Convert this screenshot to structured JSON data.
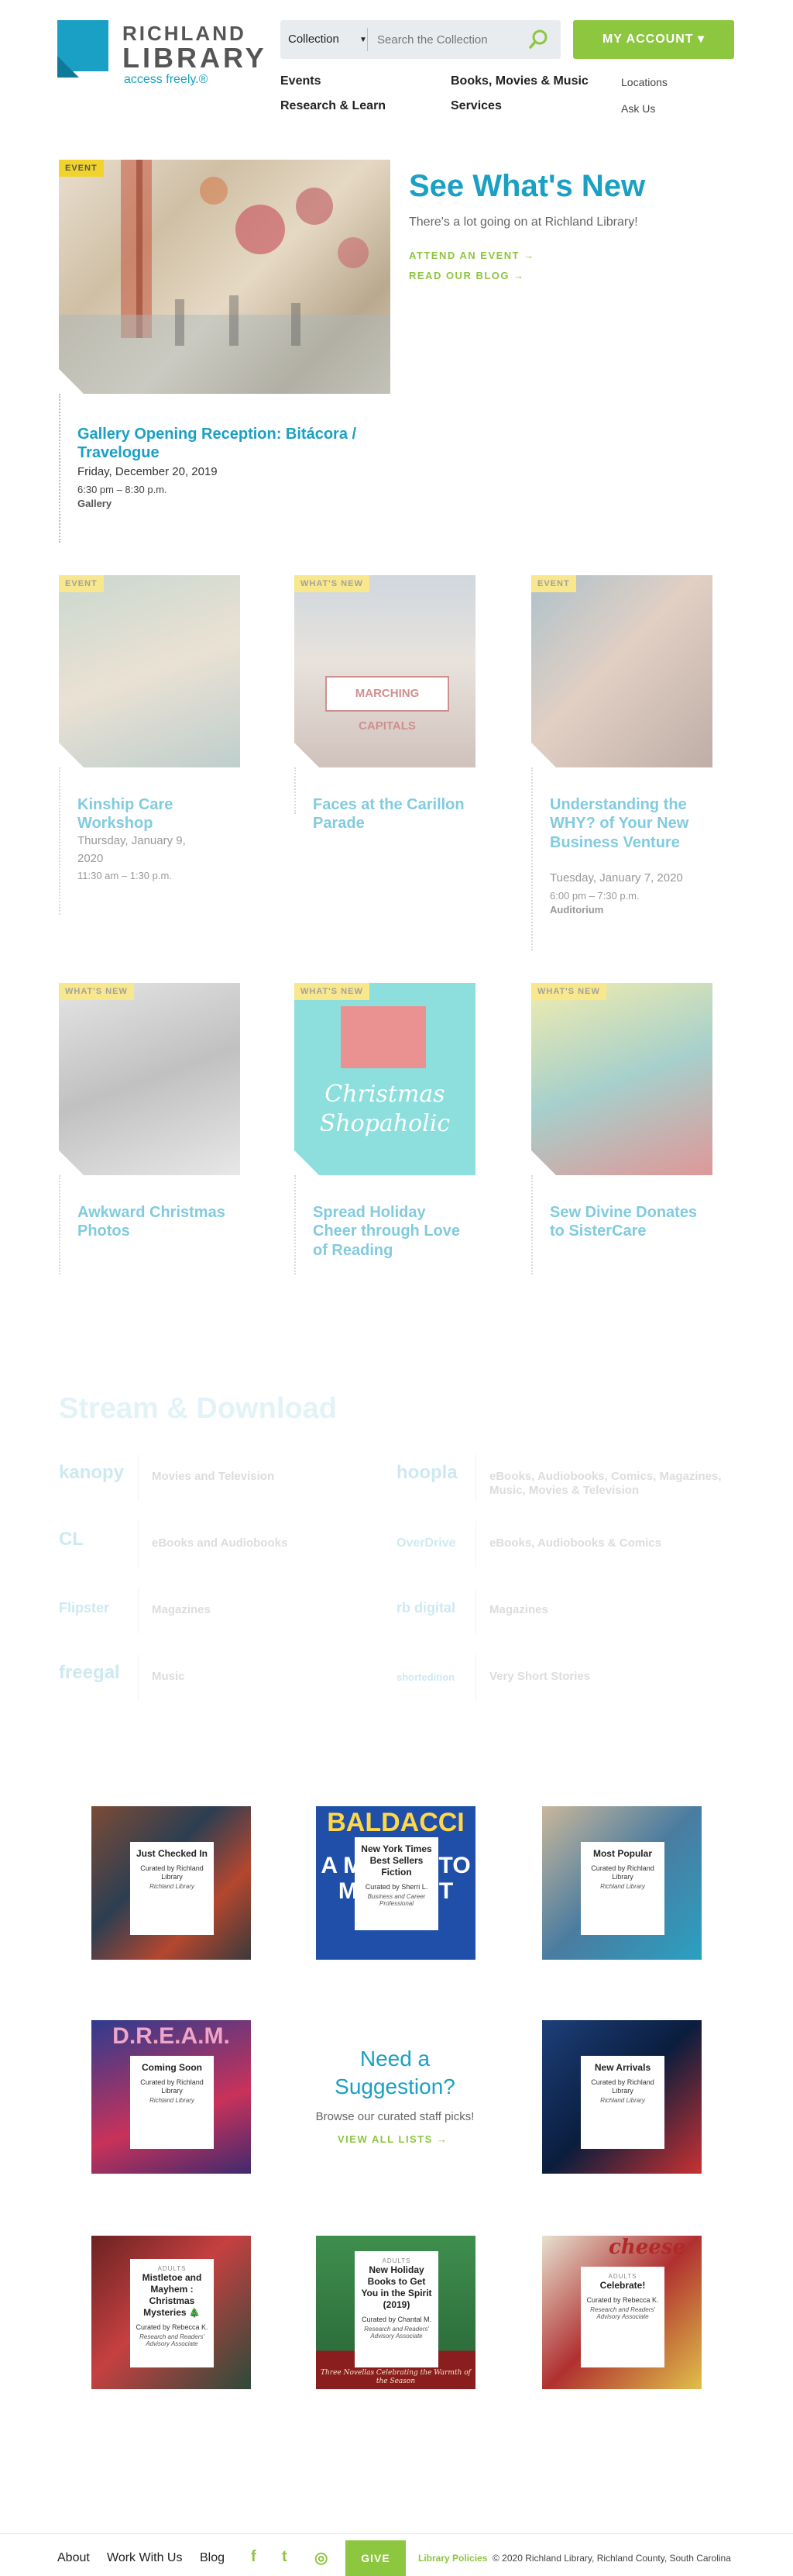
{
  "header": {
    "brand_line1": "RICHLAND",
    "brand_line2": "LIBRARY",
    "tagline": "access freely.®",
    "search_scope": "Collection",
    "search_placeholder": "Search the Collection",
    "account_label": "MY ACCOUNT"
  },
  "nav": {
    "events": "Events",
    "research": "Research & Learn",
    "books": "Books, Movies & Music",
    "services": "Services",
    "locations": "Locations",
    "ask": "Ask Us"
  },
  "featured": {
    "tag": "EVENT",
    "title": "Gallery Opening Reception: Bitácora / Travelogue",
    "date": "Friday, December 20, 2019",
    "time": "6:30 pm – 8:30 p.m.",
    "place": "Gallery"
  },
  "whats_new": {
    "title": "See What's New",
    "subtitle": "There's a lot going on at Richland Library!",
    "link1": "ATTEND AN EVENT →",
    "link2": "READ OUR BLOG →"
  },
  "cards": [
    {
      "tag": "EVENT",
      "title": "Kinship Care Workshop",
      "date": "Thursday, January 9, 2020",
      "time": "11:30 am – 1:30 p.m.",
      "place": ""
    },
    {
      "tag": "WHAT'S NEW",
      "title": "Faces at the Carillon Parade",
      "date": "",
      "time": "",
      "place": ""
    },
    {
      "tag": "EVENT",
      "title": "Understanding the WHY? of Your New Business Venture",
      "date": "Tuesday, January 7, 2020",
      "time": "6:00 pm – 7:30 p.m.",
      "place": "Auditorium"
    },
    {
      "tag": "WHAT'S NEW",
      "title": "Awkward Christmas Photos",
      "date": "",
      "time": "",
      "place": ""
    },
    {
      "tag": "WHAT'S NEW",
      "title": "Spread Holiday Cheer through Love of Reading",
      "date": "",
      "time": "",
      "place": ""
    },
    {
      "tag": "WHAT'S NEW",
      "title": "Sew Divine Donates to SisterCare",
      "date": "",
      "time": "",
      "place": ""
    }
  ],
  "card_image_text": {
    "parade": "MARCHING CAPITALS",
    "xmas_line1": "Christmas",
    "xmas_line2": "Shopaholic"
  },
  "stream": {
    "title": "Stream & Download",
    "rows": [
      {
        "logo": "kanopy",
        "text": "Movies and Television"
      },
      {
        "logo": "hoopla",
        "text": "eBooks, Audiobooks, Comics, Magazines, Music, Movies & Television"
      },
      {
        "logo": "CL",
        "text": "eBooks and Audiobooks"
      },
      {
        "logo": "OverDrive",
        "text": "eBooks, Audiobooks & Comics"
      },
      {
        "logo": "Flipster",
        "text": "Magazines"
      },
      {
        "logo": "rb digital",
        "text": "Magazines"
      },
      {
        "logo": "freegal",
        "text": "Music"
      },
      {
        "logo": "shortedition",
        "text": "Very Short Stories"
      }
    ]
  },
  "lists": [
    {
      "title": "Just Checked In",
      "by": "Curated by Richland Library",
      "sub": "Richland Library",
      "adults": ""
    },
    {
      "title": "New York Times Best Sellers Fiction",
      "by": "Curated by Sherri L.",
      "sub": "Business and Career Professional",
      "adults": ""
    },
    {
      "title": "Most Popular",
      "by": "Curated by Richland Library",
      "sub": "Richland Library",
      "adults": ""
    },
    {
      "title": "Coming Soon",
      "by": "Curated by Richland Library",
      "sub": "Richland Library",
      "adults": ""
    },
    {
      "title": "New Arrivals",
      "by": "Curated by Richland Library",
      "sub": "Richland Library",
      "adults": ""
    },
    {
      "title": "Mistletoe and Mayhem : Christmas Mysteries 🎄",
      "by": "Curated by Rebecca K.",
      "sub": "Research and Readers' Advisory Associate",
      "adults": "ADULTS"
    },
    {
      "title": "New Holiday Books to Get You in the Spirit (2019)",
      "by": "Curated by Chantal M.",
      "sub": "Research and Readers' Advisory Associate",
      "adults": "ADULTS"
    },
    {
      "title": "Celebrate!",
      "by": "Curated by Rebecca K.",
      "sub": "Research and Readers' Advisory Associate",
      "adults": "ADULTS"
    }
  ],
  "list_cover_text": {
    "baldacci": "BALDACCI",
    "midnight": "A MINUTE TO MIDNIGHT",
    "dream": "D.R.E.A.M.",
    "holiday_caption": "Three Novellas Celebrating the Warmth of the Season",
    "cheese": "cheese"
  },
  "suggestion": {
    "line1": "Need a",
    "line2": "Suggestion?",
    "sub": "Browse our curated staff picks!",
    "link": "VIEW ALL LISTS →"
  },
  "footer": {
    "about": "About",
    "work": "Work With Us",
    "blog": "Blog",
    "facebook": "f",
    "twitter": "t",
    "instagram": "◎",
    "give": "GIVE",
    "policies": "Library Policies",
    "copyright": "© 2020 Richland Library, Richland County, South Carolina"
  },
  "colors": {
    "brand_blue": "#1aa0c4",
    "accent_green": "#8dc63f",
    "tag_yellow": "#f2d32e"
  }
}
